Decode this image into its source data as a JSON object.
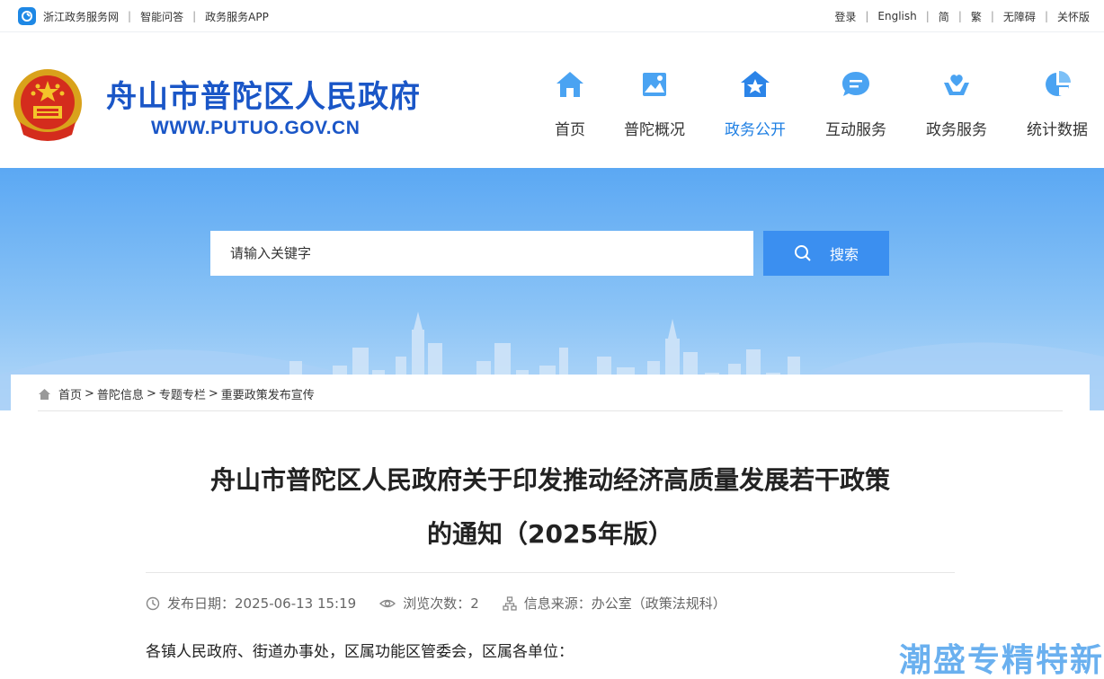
{
  "topbar": {
    "left_links": [
      "浙江政务服务网",
      "智能问答",
      "政务服务APP"
    ],
    "right_links": [
      "登录",
      "English",
      "简",
      "繁",
      "无障碍",
      "关怀版"
    ]
  },
  "header": {
    "title": "舟山市普陀区人民政府",
    "url": "WWW.PUTUO.GOV.CN"
  },
  "nav": [
    {
      "label": "首页",
      "icon": "home-icon"
    },
    {
      "label": "普陀概况",
      "icon": "landscape-icon"
    },
    {
      "label": "政务公开",
      "icon": "house-star-icon",
      "active": true
    },
    {
      "label": "互动服务",
      "icon": "chat-bubble-icon"
    },
    {
      "label": "政务服务",
      "icon": "heart-hand-icon"
    },
    {
      "label": "统计数据",
      "icon": "pie-chart-icon"
    }
  ],
  "search": {
    "placeholder": "请输入关键字",
    "button_label": "搜索"
  },
  "breadcrumb": [
    "首页",
    "普陀信息",
    "专题专栏",
    "重要政策发布宣传"
  ],
  "article": {
    "title_line1": "舟山市普陀区人民政府关于印发推动经济高质量发展若干政策",
    "title_line2": "的通知（2025年版）",
    "date_label": "发布日期：",
    "date": "2025-06-13 15:19",
    "views_label": "浏览次数：",
    "views": "2",
    "source_label": "信息来源：",
    "source": "办公室（政策法规科）",
    "salutation": "各镇人民政府、街道办事处，区属功能区管委会，区属各单位："
  },
  "watermark": "潮盛专精特新",
  "colors": {
    "brand_blue": "#1a56c7",
    "nav_active": "#1e7fe3",
    "search_button": "#3b8ff0",
    "banner_top": "#5ba8f3"
  }
}
